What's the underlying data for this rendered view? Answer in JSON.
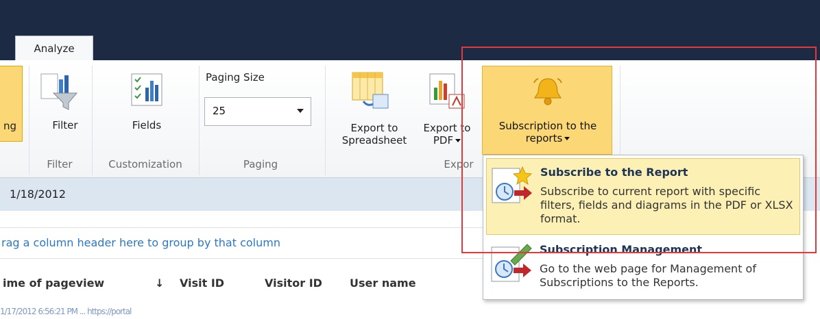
{
  "tabs": {
    "active": "Analyze"
  },
  "ribbon": {
    "prev_button_label": "ng",
    "filter": {
      "button_label": "Filter",
      "group_label": "Filter"
    },
    "customization": {
      "button_label": "Fields",
      "group_label": "Customization"
    },
    "paging": {
      "title": "Paging Size",
      "value": "25",
      "group_label": "Paging"
    },
    "export": {
      "spreadsheet_label_1": "Export to",
      "spreadsheet_label_2": "Spreadsheet",
      "pdf_label_1": "Export to",
      "pdf_label_2": "PDF",
      "group_label": "Expor"
    },
    "subscription": {
      "label_1": "Subscription to the",
      "label_2": "reports"
    }
  },
  "date_bar": {
    "date": "1/18/2012"
  },
  "group_hint": "rag a column header here to group by that column",
  "columns": [
    "ime of pageview",
    "↓",
    "Visit ID",
    "Visitor ID",
    "User name"
  ],
  "blurred_row": "1/17/2012 6:56:21 PM  ...  https://portal",
  "dropdown": {
    "items": [
      {
        "title": "Subscribe to the Report",
        "desc": "Subscribe to current report with specific filters, fields and diagrams in the PDF or XLSX format."
      },
      {
        "title": "Subscription Management",
        "desc": "Go to the web page for Management of Subscriptions to the Reports."
      }
    ]
  },
  "colors": {
    "accent": "#fbd776",
    "topbar": "#1c2a43",
    "highlight_box": "#e5383b",
    "link": "#2a79c5"
  }
}
